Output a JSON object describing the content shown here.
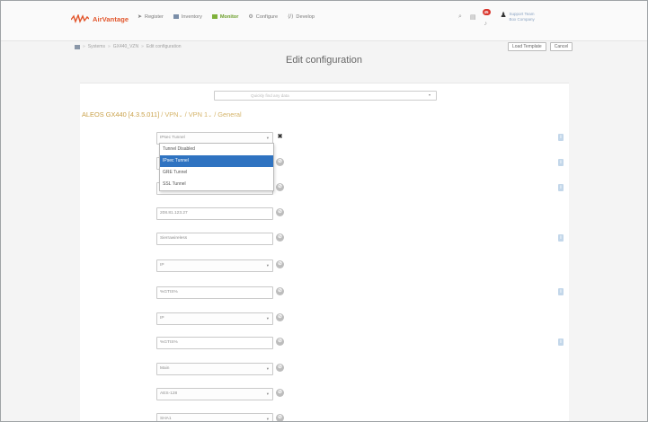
{
  "topbar": {
    "logo_text": "AirVantage",
    "nav": [
      {
        "label": "Register",
        "icon": "register-icon",
        "active": false
      },
      {
        "label": "Inventory",
        "icon": "inventory-icon",
        "active": false
      },
      {
        "label": "Monitor",
        "icon": "monitor-icon",
        "active": true
      },
      {
        "label": "Configure",
        "icon": "configure-icon",
        "active": false
      },
      {
        "label": "Develop",
        "icon": "develop-icon",
        "active": false
      }
    ],
    "notification_count": "45",
    "user": {
      "name": "Support Team",
      "company": "Box Company"
    }
  },
  "breadcrumb": [
    "Systems",
    "GX440_VZN",
    "Edit configuration"
  ],
  "buttons": {
    "load_template": "Load Template",
    "cancel": "Cancel"
  },
  "page_title": "Edit configuration",
  "search": {
    "placeholder": "Quickly find any data"
  },
  "heading": {
    "device": "ALEOS GX440 [4.3.5.011]",
    "path": " / VPN",
    "path2": " / VPN 1",
    "path3": " / General"
  },
  "colors": {
    "accent": "#7fb13a",
    "brand": "#e2562c",
    "highlight": "#2f73c1",
    "heading": "#c9a14a"
  },
  "form": [
    {
      "label": "VPN 1 Type",
      "value": "IPsec Tunnel",
      "kind": "select-open"
    },
    {
      "label": "VPN 1 Status",
      "value": "",
      "kind": "text"
    },
    {
      "label": "SNTP Server Address",
      "value": "",
      "kind": "text"
    },
    {
      "label": "VPN Gateway Address",
      "value": "208.81.123.27",
      "kind": "text"
    },
    {
      "label": "Preshared Key 1",
      "value": "Sierrawireless",
      "kind": "text"
    },
    {
      "label": "My Identity Type",
      "value": "IP",
      "kind": "select"
    },
    {
      "label": "My Identity - IP",
      "value": "%GTIS%",
      "kind": "text"
    },
    {
      "label": "Peer Identity Type",
      "value": "IP",
      "kind": "select"
    },
    {
      "label": "Peer Identity - IP",
      "value": "%GTIS%",
      "kind": "text"
    },
    {
      "label": "Negotiation Mode",
      "value": "Main",
      "kind": "select"
    },
    {
      "label": "IKE Encryption Algorithm",
      "value": "AES-128",
      "kind": "select"
    },
    {
      "label": "IKE Authentication Algorit...",
      "value": "SHA1",
      "kind": "select"
    }
  ],
  "dropdown_options": [
    "Tunnel Disabled",
    "IPsec Tunnel",
    "GRE Tunnel",
    "SSL Tunnel"
  ],
  "dropdown_selected": "IPsec Tunnel"
}
